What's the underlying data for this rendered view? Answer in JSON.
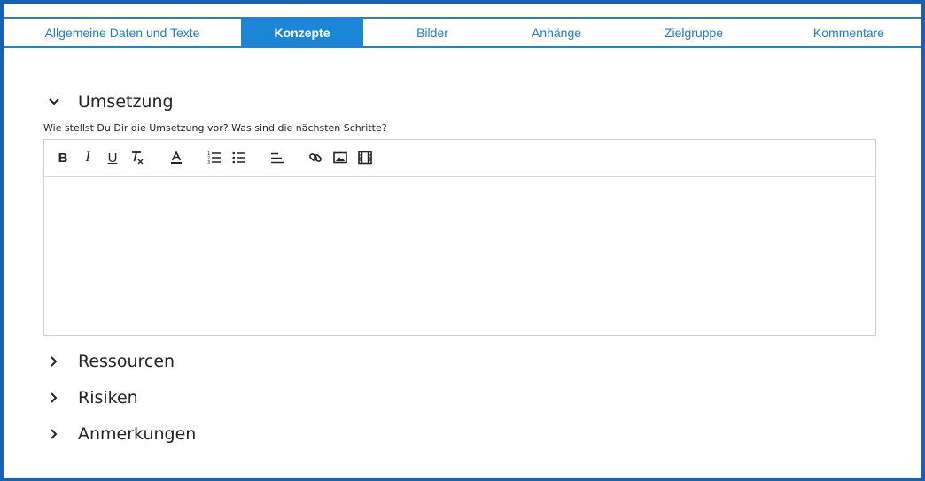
{
  "tabs": [
    {
      "label": "Allgemeine Daten und Texte",
      "active": false
    },
    {
      "label": "Konzepte",
      "active": true
    },
    {
      "label": "Bilder",
      "active": false
    },
    {
      "label": "Anhänge",
      "active": false
    },
    {
      "label": "Zielgruppe",
      "active": false
    },
    {
      "label": "Kommentare",
      "active": false
    }
  ],
  "sections": [
    {
      "title": "Umsetzung",
      "expanded": true,
      "chevron": "chevron-down-icon"
    },
    {
      "title": "Ressourcen",
      "expanded": false,
      "chevron": "chevron-right-icon"
    },
    {
      "title": "Risiken",
      "expanded": false,
      "chevron": "chevron-right-icon"
    },
    {
      "title": "Anmerkungen",
      "expanded": false,
      "chevron": "chevron-right-icon"
    }
  ],
  "umsetzung": {
    "question": "Wie stellst Du Dir die Umsetzung vor? Was sind die nächsten Schritte?",
    "editor_content": ""
  },
  "toolbar": {
    "bold": "B",
    "italic": "I",
    "underline": "U",
    "icons": [
      "bold-icon",
      "italic-icon",
      "underline-icon",
      "clear-format-icon",
      "text-color-icon",
      "ordered-list-icon",
      "bullet-list-icon",
      "align-left-icon",
      "link-icon",
      "image-icon",
      "video-icon"
    ]
  },
  "colors": {
    "accent": "#1c86d6",
    "frame": "#1464b4",
    "tab_text": "#1c7bd0"
  }
}
